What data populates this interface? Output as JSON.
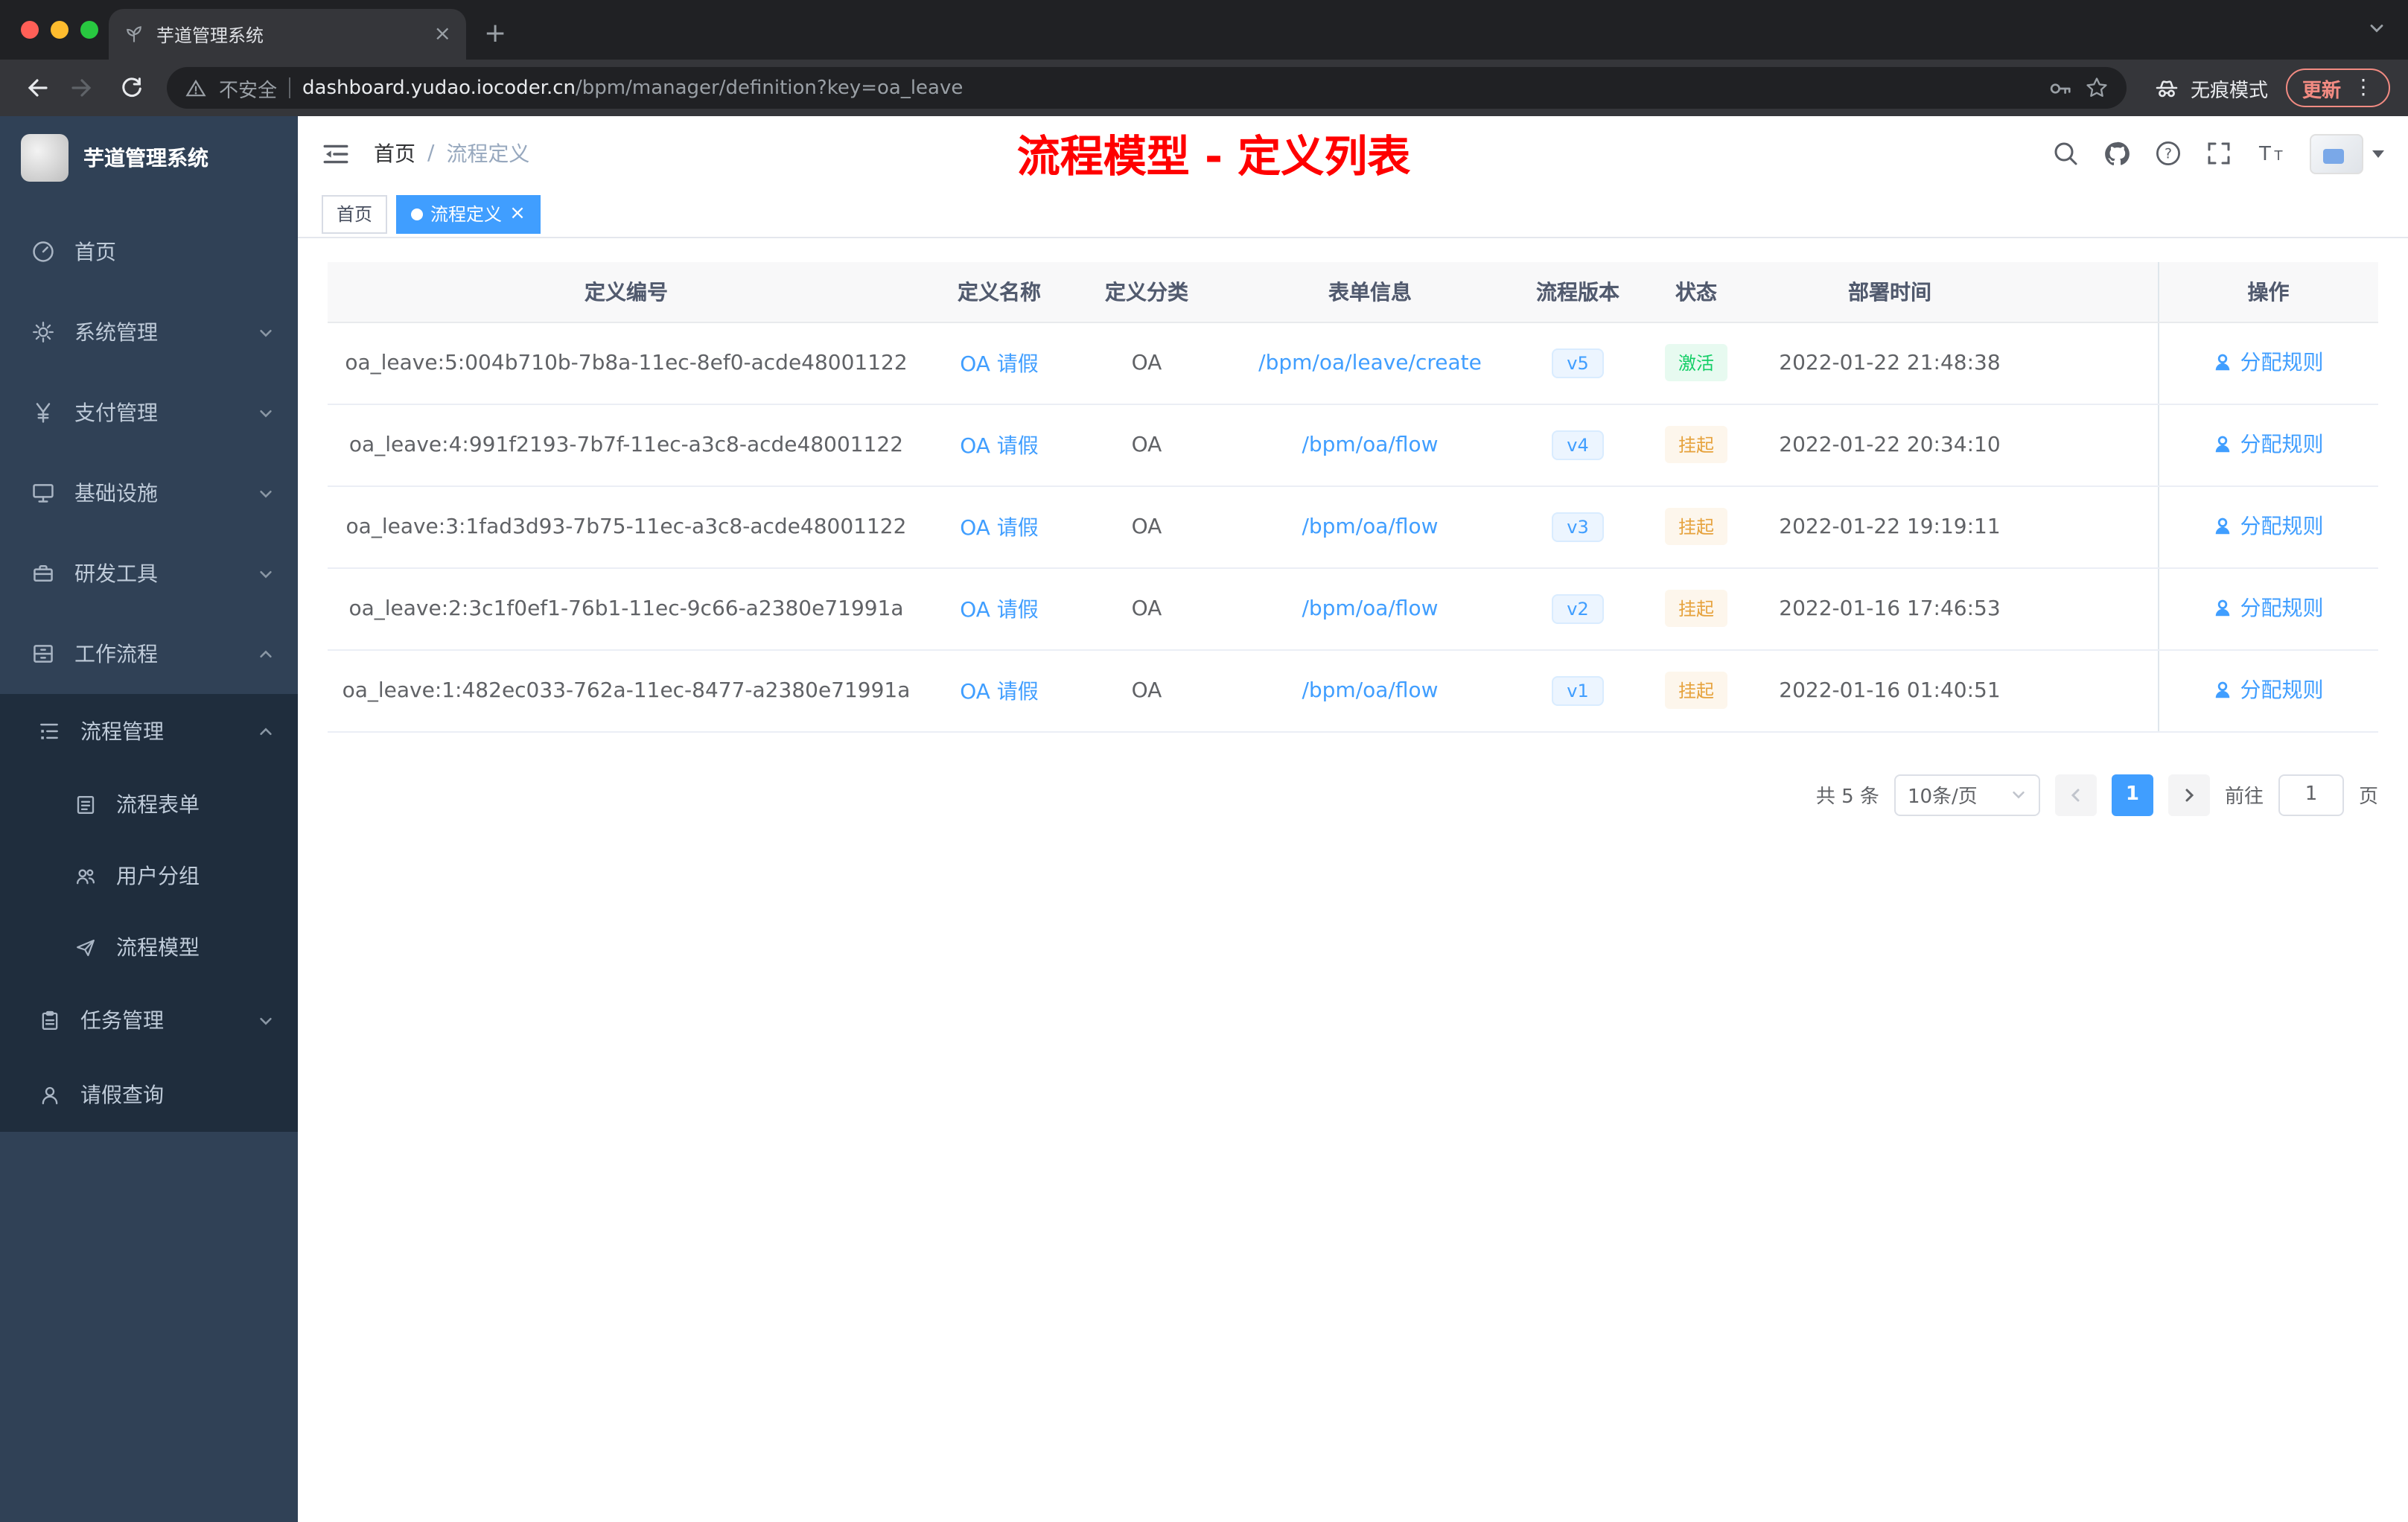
{
  "browser": {
    "tab_title": "芋道管理系统",
    "new_tab_glyph": "+",
    "close_tab_glyph": "×",
    "security_label": "不安全",
    "url_host": "dashboard.yudao.iocoder.cn",
    "url_path": "/bpm/manager/definition?key=oa_leave",
    "incognito_label": "无痕模式",
    "update_label": "更新",
    "menu_dots_glyph": "⋮"
  },
  "sidebar": {
    "logo_title": "芋道管理系统",
    "items": [
      {
        "label": "首页",
        "icon": "dashboard-icon"
      },
      {
        "label": "系统管理",
        "icon": "gear-icon"
      },
      {
        "label": "支付管理",
        "icon": "yen-icon"
      },
      {
        "label": "基础设施",
        "icon": "monitor-icon"
      },
      {
        "label": "研发工具",
        "icon": "toolbox-icon"
      },
      {
        "label": "工作流程",
        "icon": "cabinet-icon"
      },
      {
        "label": "流程管理",
        "icon": "tree-table-icon"
      },
      {
        "label": "流程表单",
        "icon": "form-icon"
      },
      {
        "label": "用户分组",
        "icon": "people-icon"
      },
      {
        "label": "流程模型",
        "icon": "paper-plane-icon"
      },
      {
        "label": "任务管理",
        "icon": "clipboard-icon"
      },
      {
        "label": "请假查询",
        "icon": "person-icon"
      }
    ]
  },
  "header": {
    "breadcrumb": [
      "首页",
      "流程定义"
    ],
    "breadcrumb_separator": "/",
    "annotation": "流程模型 - 定义列表"
  },
  "tags": [
    {
      "label": "首页"
    },
    {
      "label": "流程定义",
      "close": "×"
    }
  ],
  "table": {
    "columns": [
      "定义编号",
      "定义名称",
      "定义分类",
      "表单信息",
      "流程版本",
      "状态",
      "部署时间",
      "操作"
    ],
    "rows": [
      {
        "id": "oa_leave:5:004b710b-7b8a-11ec-8ef0-acde48001122",
        "name": "OA 请假",
        "category": "OA",
        "form": "/bpm/oa/leave/create",
        "version": "v5",
        "status": "激活",
        "time": "2022-01-22 21:48:38",
        "action": "分配规则"
      },
      {
        "id": "oa_leave:4:991f2193-7b7f-11ec-a3c8-acde48001122",
        "name": "OA 请假",
        "category": "OA",
        "form": "/bpm/oa/flow",
        "version": "v4",
        "status": "挂起",
        "time": "2022-01-22 20:34:10",
        "action": "分配规则"
      },
      {
        "id": "oa_leave:3:1fad3d93-7b75-11ec-a3c8-acde48001122",
        "name": "OA 请假",
        "category": "OA",
        "form": "/bpm/oa/flow",
        "version": "v3",
        "status": "挂起",
        "time": "2022-01-22 19:19:11",
        "action": "分配规则"
      },
      {
        "id": "oa_leave:2:3c1f0ef1-76b1-11ec-9c66-a2380e71991a",
        "name": "OA 请假",
        "category": "OA",
        "form": "/bpm/oa/flow",
        "version": "v2",
        "status": "挂起",
        "time": "2022-01-16 17:46:53",
        "action": "分配规则"
      },
      {
        "id": "oa_leave:1:482ec033-762a-11ec-8477-a2380e71991a",
        "name": "OA 请假",
        "category": "OA",
        "form": "/bpm/oa/flow",
        "version": "v1",
        "status": "挂起",
        "time": "2022-01-16 01:40:51",
        "action": "分配规则"
      }
    ]
  },
  "pagination": {
    "total": "共 5 条",
    "page_size": "10条/页",
    "current_page": "1",
    "goto_label": "前往",
    "goto_value": "1",
    "page_unit": "页"
  },
  "colors": {
    "accent_blue": "#409eff",
    "success_green": "#13ce66",
    "warning_orange": "#e6a23c",
    "annotation_red": "#ff0000",
    "sidebar_bg": "#304156",
    "sidebar_sub_bg": "#1f2d3d"
  }
}
